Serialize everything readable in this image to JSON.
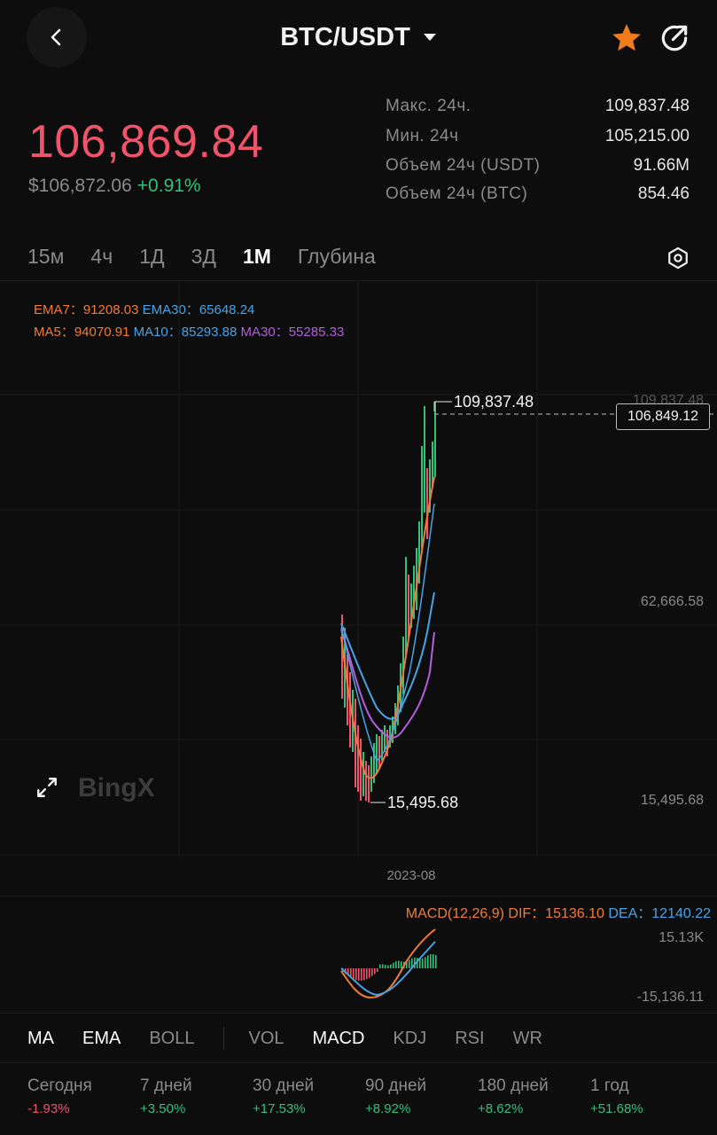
{
  "header": {
    "pair": "BTC/USDT"
  },
  "price": {
    "last": "106,869.84",
    "usd": "$106,872.06",
    "change": "+0.91%"
  },
  "stats": [
    {
      "label": "Макс. 24ч.",
      "value": "109,837.48"
    },
    {
      "label": "Мин. 24ч",
      "value": "105,215.00"
    },
    {
      "label": "Объем 24ч (USDT)",
      "value": "91.66M"
    },
    {
      "label": "Объем 24ч (BTC)",
      "value": "854.46"
    }
  ],
  "intervals": [
    {
      "label": "15м",
      "active": false
    },
    {
      "label": "4ч",
      "active": false
    },
    {
      "label": "1Д",
      "active": false
    },
    {
      "label": "3Д",
      "active": false
    },
    {
      "label": "1М",
      "active": true
    },
    {
      "label": "Глубина",
      "active": false
    }
  ],
  "indicators": {
    "ema7_label": "EMA7：",
    "ema7": "91208.03",
    "ema30_label": "EMA30：",
    "ema30": "65648.24",
    "ma5_label": "MA5：",
    "ma5": "94070.91",
    "ma10_label": "MA10：",
    "ma10": "85293.88",
    "ma30_label": "MA30：",
    "ma30": "55285.33"
  },
  "chart": {
    "axis_top": "109,837.48",
    "axis_mid": "62,666.58",
    "axis_low": "15,495.68",
    "high_marker": "109,837.48",
    "low_marker": "15,495.68",
    "current_price": "106,849.12",
    "date_label": "2023-08",
    "watermark": "BingX"
  },
  "macd": {
    "label": "MACD(12,26,9)",
    "dif_label": "DIF：",
    "dif": "15136.10",
    "dea_label": "DEA：",
    "dea": "12140.22",
    "axis_top": "15.13K",
    "axis_bottom": "-15,136.11"
  },
  "bottom_tabs": [
    {
      "label": "MA",
      "active": true
    },
    {
      "label": "EMA",
      "active": true
    },
    {
      "label": "BOLL",
      "active": false
    },
    {
      "label": "VOL",
      "active": false
    },
    {
      "label": "MACD",
      "active": true
    },
    {
      "label": "KDJ",
      "active": false
    },
    {
      "label": "RSI",
      "active": false
    },
    {
      "label": "WR",
      "active": false
    }
  ],
  "performance": [
    {
      "label": "Сегодня",
      "value": "-1.93%",
      "dir": "neg"
    },
    {
      "label": "7 дней",
      "value": "+3.50%",
      "dir": "pos"
    },
    {
      "label": "30 дней",
      "value": "+17.53%",
      "dir": "pos"
    },
    {
      "label": "90 дней",
      "value": "+8.92%",
      "dir": "pos"
    },
    {
      "label": "180 дней",
      "value": "+8.62%",
      "dir": "pos"
    },
    {
      "label": "1 год",
      "value": "+51.68%",
      "dir": "pos"
    }
  ],
  "colors": {
    "up": "#34c07b",
    "down": "#f0546b",
    "accent_star": "#f07c1e",
    "ma5": "#f07c3a",
    "ma10": "#4aa3e6",
    "ma30": "#b45fe0"
  },
  "icons": [
    "back-arrow-icon",
    "dropdown-caret-icon",
    "star-icon",
    "share-icon",
    "settings-icon",
    "fullscreen-icon"
  ]
}
